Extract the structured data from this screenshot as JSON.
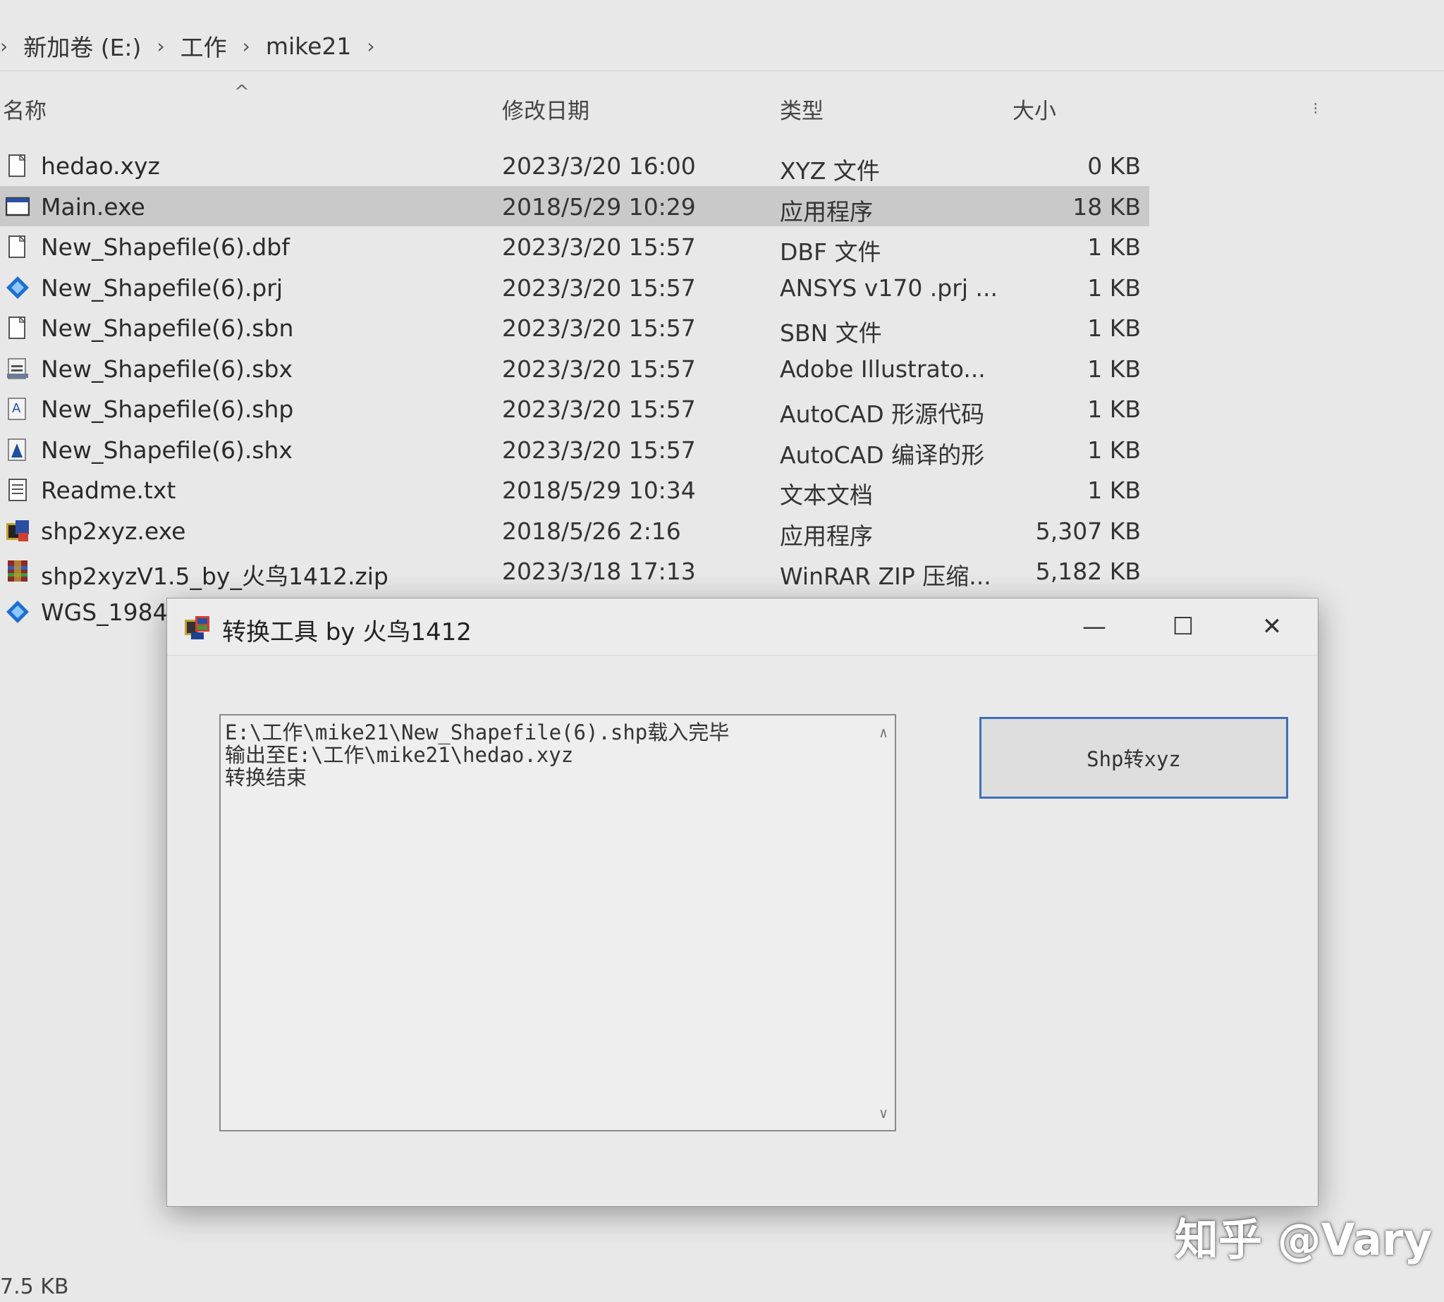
{
  "breadcrumb": [
    "新加卷 (E:)",
    "工作",
    "mike21"
  ],
  "columns": {
    "name": "名称",
    "date": "修改日期",
    "type": "类型",
    "size": "大小"
  },
  "files": [
    {
      "name": "hedao.xyz",
      "date": "2023/3/20 16:00",
      "type": "XYZ 文件",
      "size": "0 KB",
      "icon": "file-icon",
      "selected": false
    },
    {
      "name": "Main.exe",
      "date": "2018/5/29 10:29",
      "type": "应用程序",
      "size": "18 KB",
      "icon": "exe-window-icon",
      "selected": true
    },
    {
      "name": "New_Shapefile(6).dbf",
      "date": "2023/3/20 15:57",
      "type": "DBF 文件",
      "size": "1 KB",
      "icon": "file-icon",
      "selected": false
    },
    {
      "name": "New_Shapefile(6).prj",
      "date": "2023/3/20 15:57",
      "type": "ANSYS v170 .prj ...",
      "size": "1 KB",
      "icon": "ansys-icon",
      "selected": false
    },
    {
      "name": "New_Shapefile(6).sbn",
      "date": "2023/3/20 15:57",
      "type": "SBN 文件",
      "size": "1 KB",
      "icon": "file-icon",
      "selected": false
    },
    {
      "name": "New_Shapefile(6).sbx",
      "date": "2023/3/20 15:57",
      "type": "Adobe Illustrato...",
      "size": "1 KB",
      "icon": "illustrator-icon",
      "selected": false
    },
    {
      "name": "New_Shapefile(6).shp",
      "date": "2023/3/20 15:57",
      "type": "AutoCAD 形源代码",
      "size": "1 KB",
      "icon": "autocad-shape-icon",
      "selected": false
    },
    {
      "name": "New_Shapefile(6).shx",
      "date": "2023/3/20 15:57",
      "type": "AutoCAD 编译的形",
      "size": "1 KB",
      "icon": "autocad-compiled-icon",
      "selected": false
    },
    {
      "name": "Readme.txt",
      "date": "2018/5/29 10:34",
      "type": "文本文档",
      "size": "1 KB",
      "icon": "text-file-icon",
      "selected": false
    },
    {
      "name": "shp2xyz.exe",
      "date": "2018/5/26 2:16",
      "type": "应用程序",
      "size": "5,307 KB",
      "icon": "app-exe-icon",
      "selected": false
    },
    {
      "name": "shp2xyzV1.5_by_火鸟1412.zip",
      "date": "2023/3/18 17:13",
      "type": "WinRAR ZIP 压缩...",
      "size": "5,182 KB",
      "icon": "winrar-icon",
      "selected": false
    },
    {
      "name": "WGS_1984",
      "date": "",
      "type": "",
      "size": "",
      "icon": "ansys-icon",
      "selected": false
    }
  ],
  "status": {
    "size_text": "7.5 KB"
  },
  "dialog": {
    "title": "转换工具 by 火鸟1412",
    "minimize": "—",
    "maximize": "☐",
    "close": "✕",
    "log_lines": [
      "E:\\工作\\mike21\\New_Shapefile(6).shp载入完毕",
      "输出至E:\\工作\\mike21\\hedao.xyz",
      "转换结束"
    ],
    "convert_button": "Shp转xyz"
  },
  "watermark": "知乎 @Vary",
  "colors": {
    "selection": "#c9c9c9",
    "button_border": "#3f6fb8",
    "ansys_blue": "#1e6fd0"
  }
}
